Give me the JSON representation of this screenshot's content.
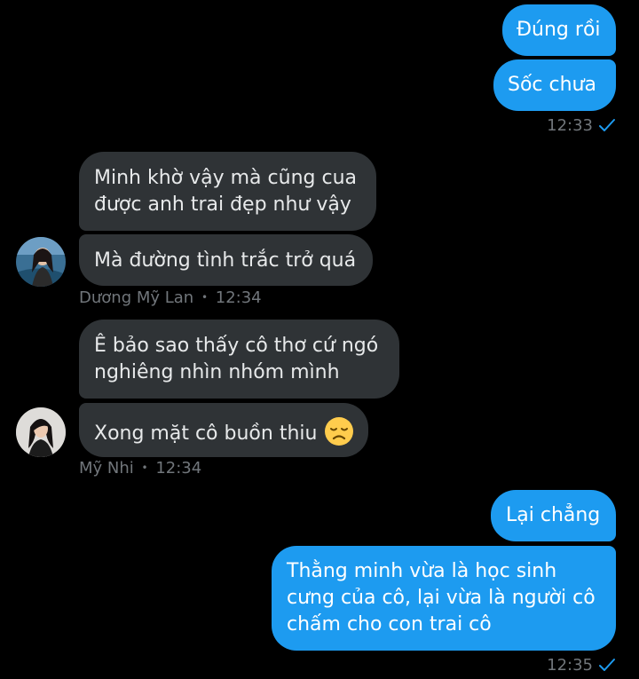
{
  "colors": {
    "background": "#000000",
    "outgoing_bubble": "#1d9bf0",
    "incoming_bubble": "#2f3336",
    "meta_text": "#71767b",
    "check": "#1d9bf0"
  },
  "messages": {
    "m1": "Đúng rồi",
    "m2": "Sốc chưa",
    "t1": "12:33",
    "m3_line1": "Minh khờ vậy mà cũng cua",
    "m3_line2": "được anh trai đẹp như vậy",
    "m4": "Mà đường tình trắc trở quá",
    "sender1": "Dương Mỹ Lan",
    "sender1_time": "12:34",
    "m5_line1": "Ê bảo sao thấy cô thơ cứ ngó",
    "m5_line2": "nghiêng nhìn nhóm mình",
    "m6": "Xong mặt cô buồn thiu",
    "m6_emoji": "disappointed-face-icon",
    "sender2": "Mỹ Nhi",
    "sender2_time": "12:34",
    "m7": "Lại chẳng",
    "m8_line1": "Thằng minh vừa là học sinh",
    "m8_line2": "cưng của cô, lại vừa là người cô",
    "m8_line3": "chấm cho con trai cô",
    "t2": "12:35"
  },
  "separator": "•"
}
